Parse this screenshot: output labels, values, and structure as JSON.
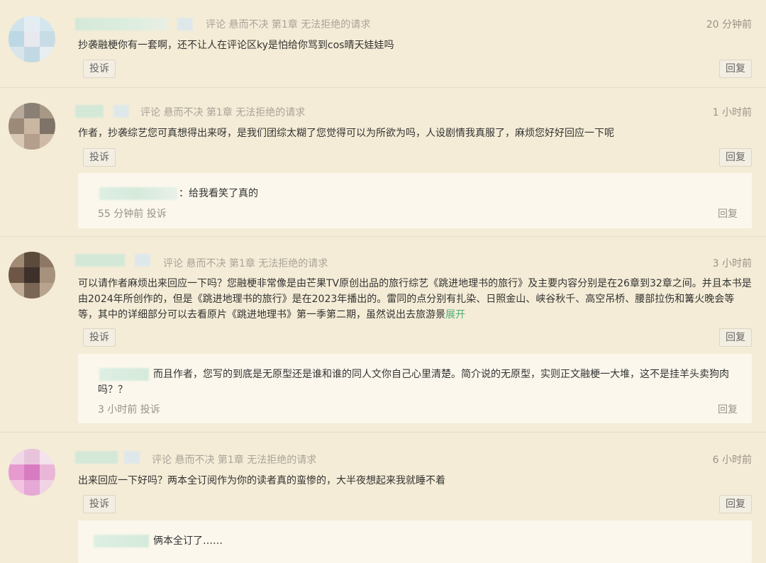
{
  "labels": {
    "report": "投诉",
    "reply": "回复",
    "expand": "展开"
  },
  "comments": [
    {
      "meta": "评论 悬而不决 第1章 无法拒绝的请求",
      "time": "20 分钟前",
      "text": "抄袭融梗你有一套啊，还不让人在评论区ky是怕给你骂到cos晴天娃娃吗"
    },
    {
      "meta": "评论 悬而不决 第1章 无法拒绝的请求",
      "time": "1 小时前",
      "text": "作者，抄袭综艺您可真想得出来呀，是我们团综太糊了您觉得可以为所欲为吗，人设剧情我真服了，麻烦您好好回应一下呢",
      "sub": {
        "text": "：给我看笑了真的",
        "meta": "55 分钟前 投诉"
      }
    },
    {
      "meta": "评论 悬而不决 第1章 无法拒绝的请求",
      "time": "3 小时前",
      "text": "可以请作者麻烦出来回应一下吗？您融梗非常像是由芒果TV原创出品的旅行综艺《跳进地理书的旅行》及主要内容分别是在26章到32章之间。并且本书是由2024年所创作的，但是《跳进地理书的旅行》是在2023年播出的。雷同的点分别有扎染、日照金山、峡谷秋千、高空吊桥、腰部拉伤和篝火晚会等等，其中的详细部分可以去看原片《跳进地理书》第一季第二期，虽然说出去旅游景",
      "sub": {
        "text": "而且作者，您写的到底是无原型还是谁和谁的同人文你自己心里清楚。简介说的无原型，实则正文融梗一大堆，这不是挂羊头卖狗肉吗？？",
        "meta": "3 小时前 投诉"
      }
    },
    {
      "meta": "评论 悬而不决 第1章 无法拒绝的请求",
      "time": "6 小时前",
      "text": "出来回应一下好吗？两本全订阅作为你的读者真的蛮惨的，大半夜想起来我就睡不着",
      "sub": {
        "text": "俩本全订了……"
      }
    }
  ]
}
